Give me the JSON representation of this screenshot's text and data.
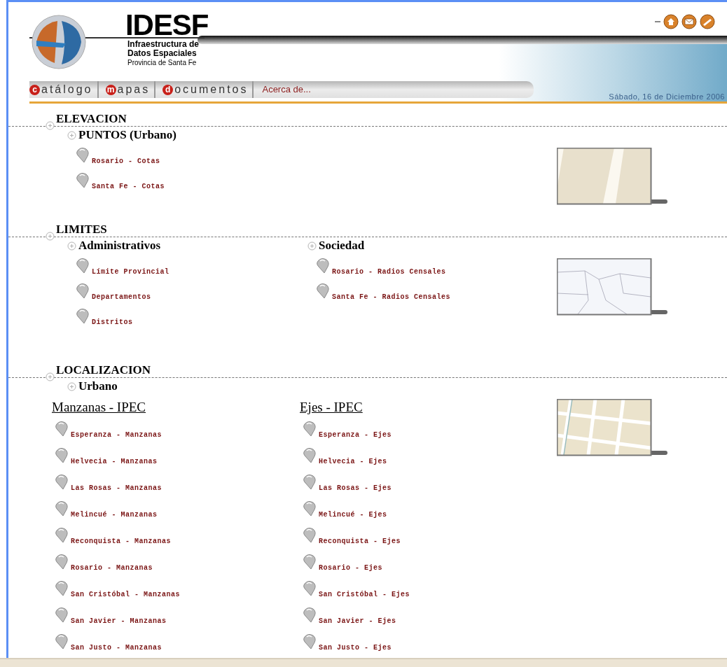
{
  "header": {
    "logo_title": "IDESF",
    "logo_line1": "Infraestructura de",
    "logo_line2": "Datos Espaciales",
    "logo_line3": "Provincia de Santa Fe",
    "date": "Sábado, 16 de Diciembre 2006"
  },
  "nav": [
    {
      "initial": "c",
      "label": "atálogo"
    },
    {
      "initial": "m",
      "label": "apas"
    },
    {
      "initial": "d",
      "label": "ocumentos"
    },
    {
      "label": "Acerca de..."
    }
  ],
  "sections": [
    {
      "title": "ELEVACION",
      "thumbnail": {
        "kind": "parcels"
      },
      "rows": [
        {
          "kind": "groups",
          "groups": [
            {
              "title": "PUNTOS (Urbano)",
              "items": [
                "Rosario - Cotas",
                "Santa Fe - Cotas"
              ]
            }
          ]
        }
      ]
    },
    {
      "title": "LIMITES",
      "thumbnail": {
        "kind": "districts"
      },
      "rows": [
        {
          "kind": "groups",
          "groups": [
            {
              "title": "Administrativos",
              "items": [
                "Límite Provincial",
                "Departamentos",
                "Distritos"
              ]
            },
            {
              "title": "Sociedad",
              "items": [
                "Rosario - Radios Censales",
                "Santa Fe - Radios Censales"
              ]
            }
          ]
        }
      ]
    },
    {
      "title": "LOCALIZACION",
      "thumbnail": {
        "kind": "streets"
      },
      "rows": [
        {
          "kind": "heading",
          "title": "Urbano"
        },
        {
          "kind": "lists",
          "lists": [
            {
              "heading": "Manzanas - IPEC",
              "items": [
                "Esperanza - Manzanas",
                "Helvecia - Manzanas",
                "Las Rosas - Manzanas",
                "Melincué - Manzanas",
                "Reconquista - Manzanas",
                "Rosario - Manzanas",
                "San Cristóbal - Manzanas",
                "San Javier - Manzanas",
                "San Justo - Manzanas"
              ]
            },
            {
              "heading": "Ejes - IPEC",
              "items": [
                "Esperanza - Ejes",
                "Helvecia - Ejes",
                "Las Rosas - Ejes",
                "Melincué - Ejes",
                "Reconquista - Ejes",
                "Rosario - Ejes",
                "San Cristóbal - Ejes",
                "San Javier - Ejes",
                "San Justo - Ejes"
              ]
            }
          ]
        }
      ]
    }
  ]
}
